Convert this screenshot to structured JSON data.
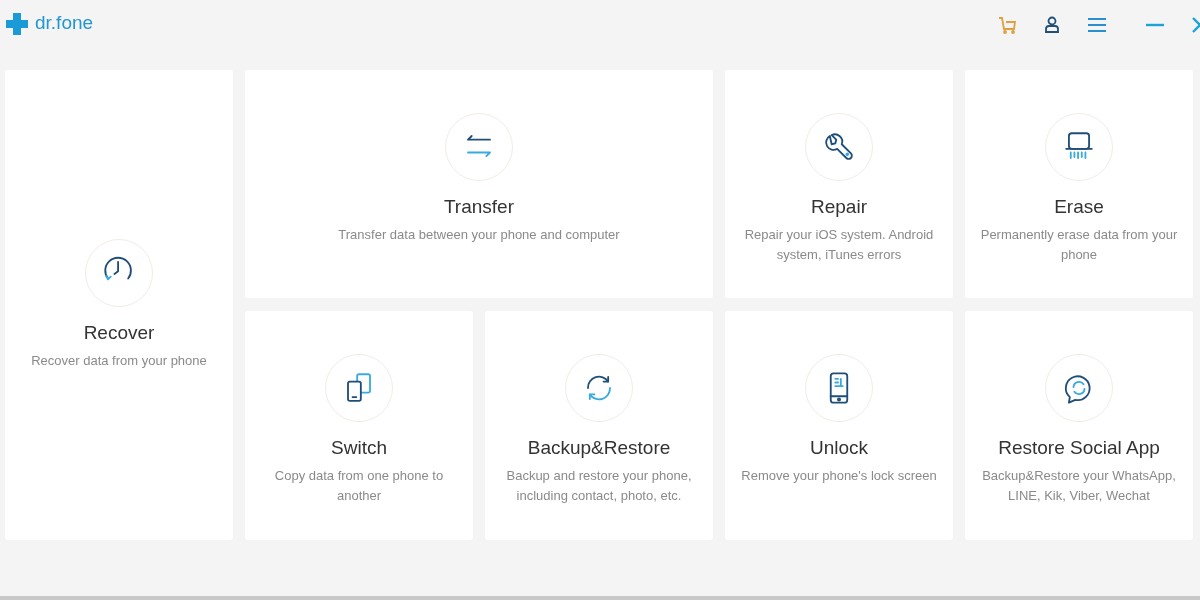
{
  "app": {
    "logo": "dr.fone"
  },
  "tools": [
    {
      "kind": "recover",
      "title": "Recover",
      "description": "Recover data from your phone"
    },
    {
      "kind": "transfer",
      "title": "Transfer",
      "description": "Transfer data between your phone and computer"
    },
    {
      "kind": "repair",
      "title": "Repair",
      "description": "Repair your iOS system. Android system, iTunes errors"
    },
    {
      "kind": "erase",
      "title": "Erase",
      "description": "Permanently erase data from your phone"
    },
    {
      "kind": "switch",
      "title": "Switch",
      "description": "Copy data from one phone to another"
    },
    {
      "kind": "backup",
      "title": "Backup&Restore",
      "description": "Backup and restore your phone, including contact, photo, etc."
    },
    {
      "kind": "unlock",
      "title": "Unlock",
      "description": "Remove your phone's lock screen"
    },
    {
      "kind": "social",
      "title": "Restore Social App",
      "description": "Backup&Restore your WhatsApp, LINE, Kik, Viber, Wechat"
    }
  ]
}
